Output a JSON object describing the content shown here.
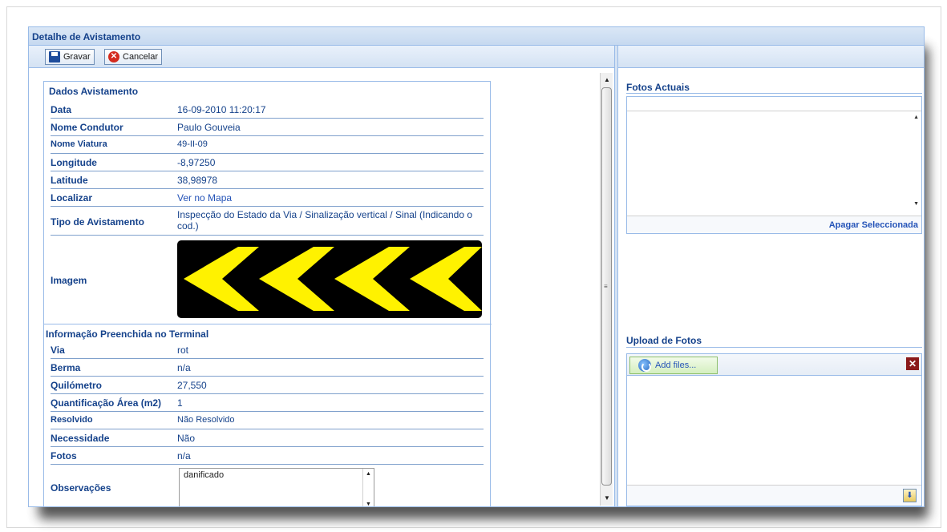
{
  "window": {
    "title": "Detalhe de Avistamento"
  },
  "toolbar": {
    "save_label": "Gravar",
    "cancel_label": "Cancelar"
  },
  "sighting": {
    "section_title": "Dados Avistamento",
    "rows": [
      {
        "label": "Data",
        "value": "16-09-2010 11:20:17"
      },
      {
        "label": "Nome Condutor",
        "value": "Paulo Gouveia"
      },
      {
        "label": "Nome Viatura",
        "value": "49-II-09"
      },
      {
        "label": "Longitude",
        "value": "-8,97250"
      },
      {
        "label": "Latitude",
        "value": "38,98978"
      },
      {
        "label": "Localizar",
        "value": "Ver no Mapa"
      },
      {
        "label": "Tipo de Avistamento",
        "value": "Inspecção do Estado da Via / Sinalização vertical / Sinal (Indicando o cod.)"
      },
      {
        "label": "Imagem",
        "value": ""
      }
    ]
  },
  "terminal": {
    "section_title": "Informação Preenchida no Terminal",
    "rows": [
      {
        "label": "Via",
        "value": "rot"
      },
      {
        "label": "Berma",
        "value": "n/a"
      },
      {
        "label": "Quilómetro",
        "value": "27,550"
      },
      {
        "label": "Quantificação Área (m2)",
        "value": "1"
      },
      {
        "label": "Resolvido",
        "value": "Não Resolvido"
      },
      {
        "label": "Necessidade",
        "value": "Não"
      },
      {
        "label": "Fotos",
        "value": "n/a"
      },
      {
        "label": "Observações",
        "value": "danificado"
      }
    ]
  },
  "photos": {
    "title": "Fotos Actuais",
    "delete_label": "Apagar Seleccionada"
  },
  "upload": {
    "title": "Upload de Fotos",
    "add_files_label": "Add files..."
  },
  "colors": {
    "header_text": "#15428b",
    "border": "#99bbe8",
    "sign_background": "#000000",
    "sign_chevron": "#fff200"
  },
  "icons": {
    "save": "save-icon",
    "cancel": "cancel-icon",
    "add_files": "refresh-icon",
    "remove": "close-icon",
    "start_upload": "upload-icon"
  }
}
